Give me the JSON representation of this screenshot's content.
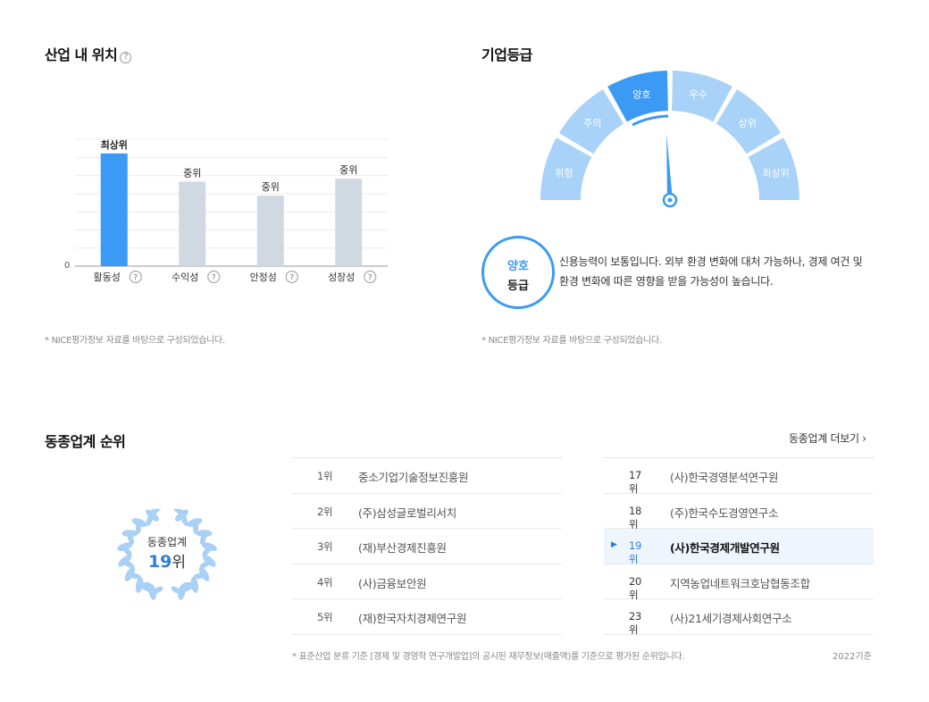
{
  "industry_position": {
    "title": "산업 내 위치",
    "help": "?",
    "zero_label": "0",
    "footnote": "* NICE평가정보 자료를 바탕으로 구성되었습니다."
  },
  "chart_data": {
    "type": "bar",
    "categories": [
      "활동성",
      "수익성",
      "안정성",
      "성장성"
    ],
    "values": [
      4,
      3,
      2.5,
      3.1
    ],
    "data_labels": [
      "최상위",
      "중위",
      "중위",
      "중위"
    ],
    "highlight_index": 0,
    "ylim": [
      0,
      4.5
    ],
    "grid": true,
    "colors": {
      "highlight": "#3b9af3",
      "normal": "#d0d9e2"
    }
  },
  "company_grade": {
    "title": "기업등급",
    "segments": [
      "위험",
      "주의",
      "양호",
      "우수",
      "상위",
      "최상위"
    ],
    "current_index": 2,
    "circle_line1": "양호",
    "circle_line2": "등급",
    "description": "신용능력이 보통입니다. 외부 환경 변화에 대처 가능하나, 경제 여건 및 환경 변화에 따른 영향을 받을 가능성이 높습니다.",
    "footnote": "* NICE평가정보 자료를 바탕으로 구성되었습니다.",
    "colors": {
      "active": "#3b9af3",
      "inactive": "#a8d2f8",
      "needle": "#3b9af3"
    }
  },
  "peer_ranking": {
    "title": "동종업계 순위",
    "more_link": "동종업계 더보기 ›",
    "badge_label": "동종업계",
    "badge_rank": "19",
    "badge_unit": "위",
    "left_list": [
      {
        "rank": "1위",
        "name": "중소기업기술정보진흥원"
      },
      {
        "rank": "2위",
        "name": "(주)삼성글로벌리서치"
      },
      {
        "rank": "3위",
        "name": "(재)부산경제진흥원"
      },
      {
        "rank": "4위",
        "name": "(사)금융보안원"
      },
      {
        "rank": "5위",
        "name": "(재)한국자치경제연구원"
      }
    ],
    "right_list": [
      {
        "rank": "17위",
        "name": "(사)한국경영분석연구원"
      },
      {
        "rank": "18위",
        "name": "(주)한국수도경영연구소"
      },
      {
        "rank": "19위",
        "name": "(사)한국경제개발연구원"
      },
      {
        "rank": "20위",
        "name": "지역농업네트워크호남협동조합"
      },
      {
        "rank": "23위",
        "name": "(사)21세기경제사회연구소"
      }
    ],
    "current_marker": "▶",
    "footnote": "* 표준산업 분류 기준 [경제 및 경영학 연구개발업]의 공시된 재무정보(매출액)를 기준으로 평가된 순위입니다.",
    "base_year": "2022기준"
  }
}
